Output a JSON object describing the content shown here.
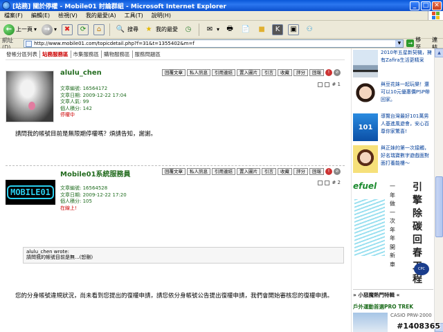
{
  "window": {
    "title": "[站務] 關於停權 - Mobile01 討論群組 - Microsoft Internet Explorer",
    "minimize": "_",
    "maximize": "□",
    "close": "✕"
  },
  "menubar": {
    "items": [
      "檔案(F)",
      "編輯(E)",
      "檢視(V)",
      "我的最愛(A)",
      "工具(T)",
      "說明(H)"
    ]
  },
  "toolbar": {
    "back_label": "上一頁",
    "search_label": "搜尋",
    "favorites_label": "我的最愛"
  },
  "addressbar": {
    "label": "網址(D)",
    "url": "http://www.mobile01.com/topicdetail.php?f=31&t=1355402&m=f",
    "go_label": "移至",
    "links_label": "連結"
  },
  "subnav": {
    "items": [
      "發帳分區列表",
      "站務服務區",
      "市集服務區",
      "購物服務區",
      "服務問題區"
    ],
    "active_index": 1
  },
  "post_actions": [
    "回覆文章",
    "私人訊息",
    "引用連結",
    "置入圖片",
    "引言",
    "收藏",
    "評分",
    "回報"
  ],
  "posts": [
    {
      "author": "alulu_chen",
      "number": "# 1",
      "meta": {
        "article_id": "文章編號: 16564172",
        "date": "文章日期: 2009-12-22 17:04",
        "popularity": "文章人氣: 99",
        "points": "個人積分: 142",
        "status": "停權中"
      },
      "body": "請問我的帳號目前是無限期停權嗎？煩請告知，謝謝。"
    },
    {
      "author": "Mobile01系統服務員",
      "number": "# 2",
      "avatar_text": "MOBILE01",
      "meta": {
        "article_id": "文章編號: 16564528",
        "date": "文章日期: 2009-12-22 17:20",
        "points": "個人積分: 105",
        "status": "在線上!"
      },
      "quote_author": "alulu_chen wrote:",
      "quote_text": "請問我的帳號目前是無...(恕刪)",
      "body": "您的分身帳號違規狀況，尚未看到您提出的復權申請，請您依分身帳號公告提出復權申請，我們會開始審核您的復權申請。"
    }
  ],
  "sidebar": {
    "ads": [
      {
        "text": "2010年五星新契機，擁有Zafira生活更精采"
      },
      {
        "text": "與豆花妹一起玩樂！還可以10元優惠價PSP帶回家。"
      },
      {
        "text": "導覽台灣最好101萬男人基進風遊會，安心百尊你家驚喜!",
        "thumb_text": "101"
      },
      {
        "text": "與正妹的第一次接觸，好名瑞寶數字遊戲面對面打養能樓～"
      }
    ],
    "efuel": {
      "brand": "efuel",
      "small_col": "一年做一次年年開新車",
      "big_col": "引擎除碳回春工程",
      "corp": "CPC"
    },
    "section_title": "» 小惡魔熱門特輯 «",
    "sub_title": "戶外運動首選PRO TREK",
    "promo_text": "CASIO PRW-2000"
  },
  "watermark": "#1408365"
}
